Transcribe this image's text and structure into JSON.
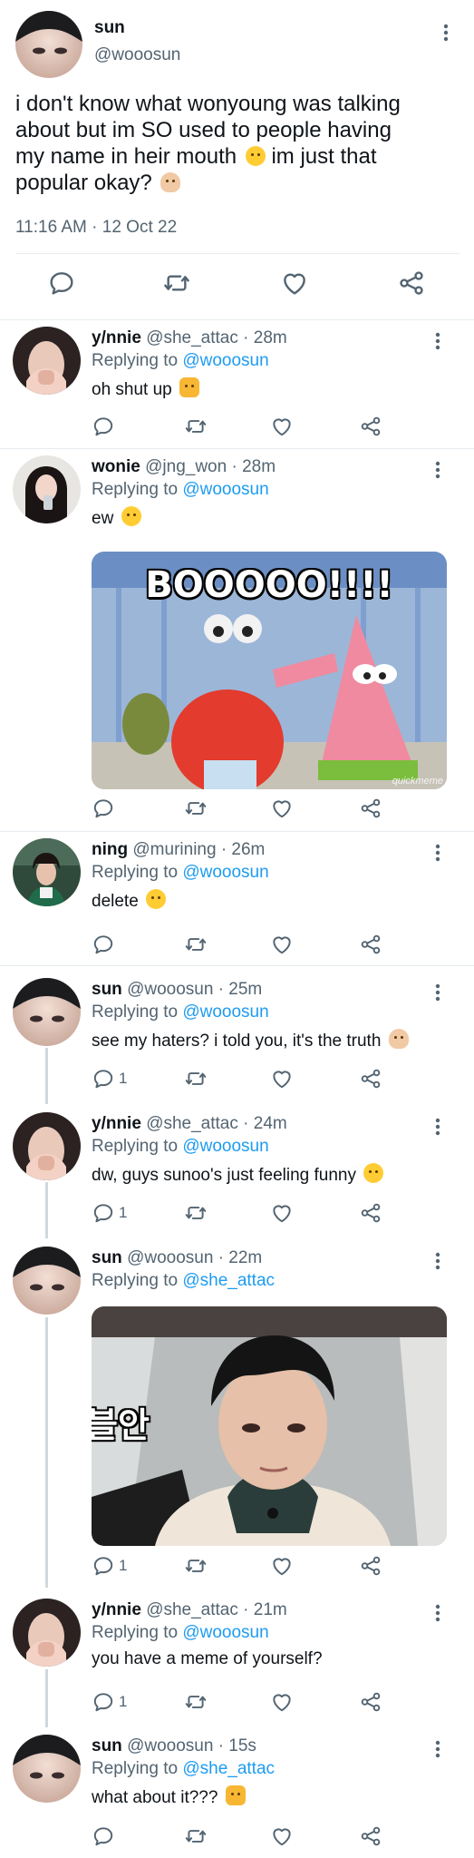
{
  "main_tweet": {
    "name": "sun",
    "handle": "@wooosun",
    "text_line1": "i don't know what wonyoung was talking",
    "text_line2": "about but im SO used to people having",
    "text_line3_a": "my name in heir mouth",
    "text_line3_b": "im just that",
    "text_line4": "popular okay?",
    "timestamp": "11:16 AM · 12 Oct 22"
  },
  "replies": [
    {
      "name": "y/nnie",
      "handle": "@she_attac · 28m",
      "replying_prefix": "Replying to ",
      "replying_to": "@wooosun",
      "text": "oh shut up",
      "reply_count": ""
    },
    {
      "name": "wonie",
      "handle": "@jng_won · 28m",
      "replying_prefix": "Replying to ",
      "replying_to": "@wooosun",
      "text": "ew",
      "media_caption": "BOOOOO!!!!",
      "media_watermark": "quickmeme",
      "reply_count": ""
    },
    {
      "name": "ning",
      "handle": "@murining · 26m",
      "replying_prefix": "Replying to ",
      "replying_to": "@wooosun",
      "text": "delete",
      "reply_count": ""
    },
    {
      "name": "sun",
      "handle": "@wooosun · 25m",
      "replying_prefix": "Replying to ",
      "replying_to": "@wooosun",
      "text": "see my haters? i told you, it's the truth",
      "reply_count": "1"
    },
    {
      "name": "y/nnie",
      "handle": "@she_attac · 24m",
      "replying_prefix": "Replying to ",
      "replying_to": "@wooosun",
      "text": "dw, guys sunoo's just feeling funny",
      "reply_count": "1"
    },
    {
      "name": "sun",
      "handle": "@wooosun · 22m",
      "replying_prefix": "Replying to ",
      "replying_to": "@she_attac",
      "text": "",
      "media_caption": "블안",
      "reply_count": "1"
    },
    {
      "name": "y/nnie",
      "handle": "@she_attac · 21m",
      "replying_prefix": "Replying to ",
      "replying_to": "@wooosun",
      "text": "you have a meme of yourself?",
      "reply_count": "1"
    },
    {
      "name": "sun",
      "handle": "@wooosun · 15s",
      "replying_prefix": "Replying to ",
      "replying_to": "@she_attac",
      "text": "what about it???",
      "reply_count": ""
    }
  ],
  "icons": {
    "reply": "reply-icon",
    "retweet": "retweet-icon",
    "like": "heart-icon",
    "share": "share-icon",
    "more": "more-vertical-icon"
  },
  "colors": {
    "text": "#0f1419",
    "secondary": "#536471",
    "link": "#1d9bf0",
    "divider": "#e6ecf0",
    "thread": "#cfd9de"
  }
}
